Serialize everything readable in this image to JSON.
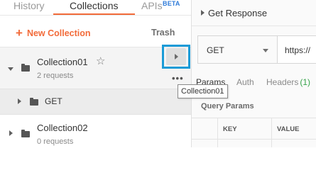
{
  "colors": {
    "accent": "#f26b3a",
    "beta_badge": "#2f7bd8",
    "highlight_box": "#1a9bd7",
    "headers_count": "#36a34a"
  },
  "sidebar": {
    "tabs": [
      {
        "label": "History",
        "active": false
      },
      {
        "label": "Collections",
        "active": true
      },
      {
        "label": "APIs",
        "active": false
      }
    ],
    "apis_badge": "BETA",
    "new_collection_icon": "+",
    "new_collection_label": "New Collection",
    "trash_label": "Trash",
    "collections": [
      {
        "name": "Collection01",
        "count": "2 requests",
        "expanded": true,
        "starred_icon": "☆",
        "requests": [
          {
            "label": "GET"
          }
        ]
      },
      {
        "name": "Collection02",
        "count": "0 requests",
        "expanded": false
      }
    ],
    "more_icon": "•••"
  },
  "tooltip": {
    "text": "Collection01"
  },
  "request_panel": {
    "title": "Get Response",
    "method": "GET",
    "url_prefix": "https://",
    "tabs": [
      {
        "label": "Params",
        "active": true
      },
      {
        "label": "Auth",
        "active": false
      },
      {
        "label": "Headers",
        "count": "(1)",
        "active": false
      }
    ],
    "query_params_label": "Query Params",
    "table_columns": [
      "KEY",
      "VALUE"
    ]
  }
}
